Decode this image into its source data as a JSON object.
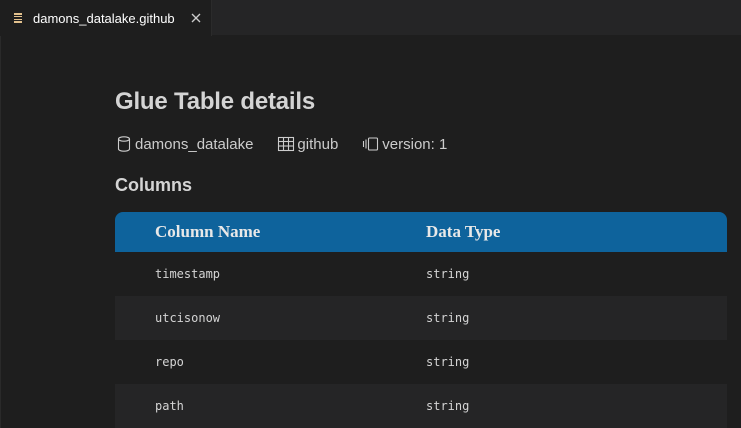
{
  "tab": {
    "label": "damons_datalake.github",
    "icon": "list-icon",
    "close_icon": "close-icon",
    "icon_color": "#e2c08d"
  },
  "page": {
    "title": "Glue Table details",
    "database": "damons_datalake",
    "table": "github",
    "version": "version: 1",
    "columns_heading": "Columns"
  },
  "columns_table": {
    "header_color": "#0e639c",
    "headers": {
      "name": "Column Name",
      "type": "Data Type"
    },
    "rows": [
      {
        "name": "timestamp",
        "type": "string"
      },
      {
        "name": "utcisonow",
        "type": "string"
      },
      {
        "name": "repo",
        "type": "string"
      },
      {
        "name": "path",
        "type": "string"
      }
    ]
  }
}
